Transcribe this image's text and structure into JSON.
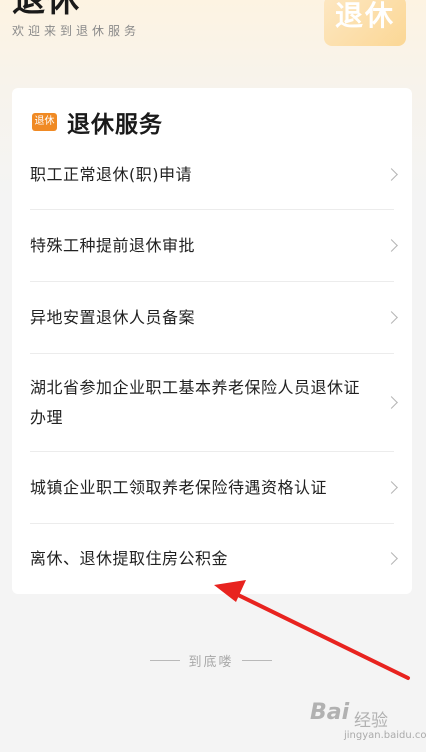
{
  "header": {
    "title": "退休",
    "subtitle": "欢迎来到退休服务",
    "badge_text": "退休"
  },
  "card": {
    "tag_label": "退休",
    "title": "退休服务",
    "items": [
      {
        "label": "职工正常退休(职)申请"
      },
      {
        "label": "特殊工种提前退休审批"
      },
      {
        "label": "异地安置退休人员备案"
      },
      {
        "label": "湖北省参加企业职工基本养老保险人员退休证办理"
      },
      {
        "label": "城镇企业职工领取养老保险待遇资格认证"
      },
      {
        "label": "离休、退休提取住房公积金"
      }
    ]
  },
  "footer": {
    "end_text": "到底喽"
  },
  "watermark": {
    "brand": "Bai",
    "sub": "经验",
    "url": "jingyan.baidu.com"
  },
  "colors": {
    "accent": "#f08a24",
    "annotation_arrow": "#e8231f"
  }
}
